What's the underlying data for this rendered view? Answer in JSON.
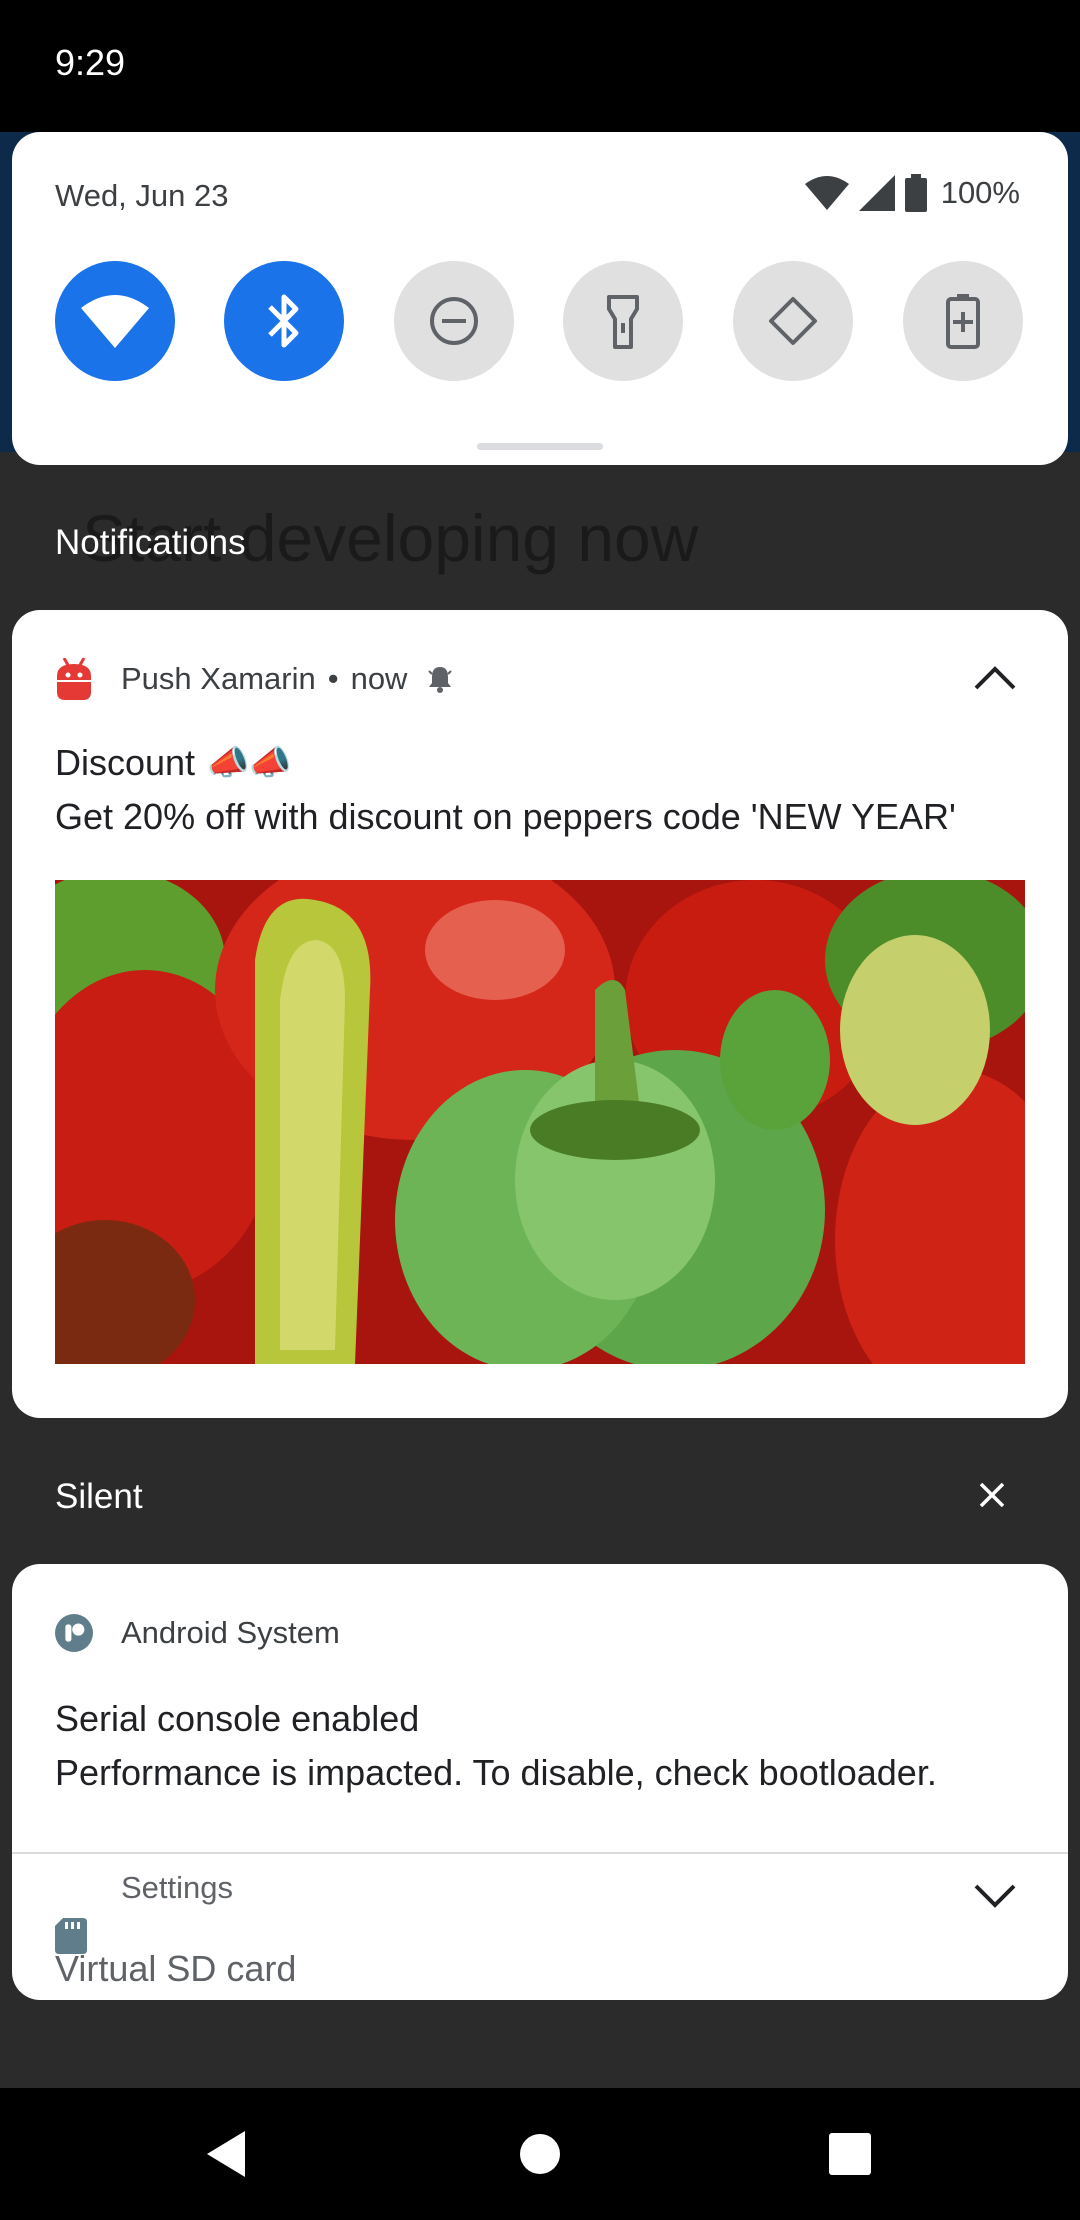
{
  "status_bar": {
    "time": "9:29"
  },
  "background_app": {
    "heading": "Start developing now"
  },
  "quick_settings": {
    "date": "Wed, Jun 23",
    "battery": "100%",
    "tiles": [
      {
        "name": "wifi",
        "icon": "wifi-icon",
        "active": true
      },
      {
        "name": "bluetooth",
        "icon": "bluetooth-icon",
        "active": true
      },
      {
        "name": "do-not-disturb",
        "icon": "do-not-disturb-icon",
        "active": false
      },
      {
        "name": "flashlight",
        "icon": "flashlight-icon",
        "active": false
      },
      {
        "name": "auto-rotate",
        "icon": "auto-rotate-icon",
        "active": false
      },
      {
        "name": "battery-saver",
        "icon": "battery-saver-icon",
        "active": false
      }
    ]
  },
  "notifications": {
    "section_title": "Notifications",
    "push": {
      "app_name": "Push Xamarin",
      "separator": "•",
      "time": "now",
      "title": "Discount",
      "title_emoji": "📣📣",
      "text": "Get 20% off with discount on peppers code 'NEW YEAR'",
      "image": "peppers"
    }
  },
  "silent": {
    "section_title": "Silent",
    "android_system": {
      "app_name": "Android System",
      "title": "Serial console enabled",
      "text": "Performance is impacted. To disable, check bootloader."
    },
    "settings": {
      "app_name": "Settings",
      "title": "Virtual SD card"
    }
  },
  "colors": {
    "accent": "#1a73e8",
    "tile_inactive": "#e0e0e0",
    "app_icon_red": "#e53935",
    "system_icon": "#607d8b"
  }
}
